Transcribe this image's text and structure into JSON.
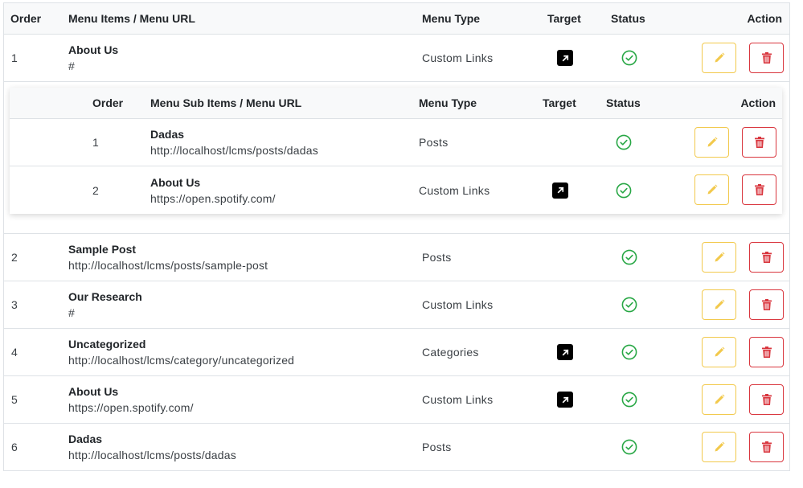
{
  "header": {
    "order": "Order",
    "items": "Menu Items / Menu URL",
    "type": "Menu Type",
    "target": "Target",
    "status": "Status",
    "action": "Action"
  },
  "sub_header": {
    "order": "Order",
    "items": "Menu Sub Items / Menu URL",
    "type": "Menu Type",
    "target": "Target",
    "status": "Status",
    "action": "Action"
  },
  "rows": [
    {
      "order": "1",
      "name": "About Us",
      "url": "#",
      "type": "Custom Links",
      "target": true,
      "status": "active"
    },
    {
      "order": "2",
      "name": "Sample Post",
      "url": "http://localhost/lcms/posts/sample-post",
      "type": "Posts",
      "target": false,
      "status": "active"
    },
    {
      "order": "3",
      "name": "Our Research",
      "url": "#",
      "type": "Custom Links",
      "target": false,
      "status": "active"
    },
    {
      "order": "4",
      "name": "Uncategorized",
      "url": "http://localhost/lcms/category/uncategorized",
      "type": "Categories",
      "target": true,
      "status": "active"
    },
    {
      "order": "5",
      "name": "About Us",
      "url": "https://open.spotify.com/",
      "type": "Custom Links",
      "target": true,
      "status": "active"
    },
    {
      "order": "6",
      "name": "Dadas",
      "url": "http://localhost/lcms/posts/dadas",
      "type": "Posts",
      "target": false,
      "status": "active"
    }
  ],
  "sub_rows": [
    {
      "order": "1",
      "name": "Dadas",
      "url": "http://localhost/lcms/posts/dadas",
      "type": "Posts",
      "target": false,
      "status": "active"
    },
    {
      "order": "2",
      "name": "About Us",
      "url": "https://open.spotify.com/",
      "type": "Custom Links",
      "target": true,
      "status": "active"
    }
  ],
  "icons": {
    "target": "external-link-icon",
    "status": "check-circle-icon",
    "edit": "pencil-icon",
    "delete": "trash-icon"
  },
  "colors": {
    "status_green": "#28a745",
    "edit_yellow": "#f2c94c",
    "delete_red": "#d9363e",
    "header_bg": "#f8f9fa",
    "border": "#dee2e6"
  }
}
